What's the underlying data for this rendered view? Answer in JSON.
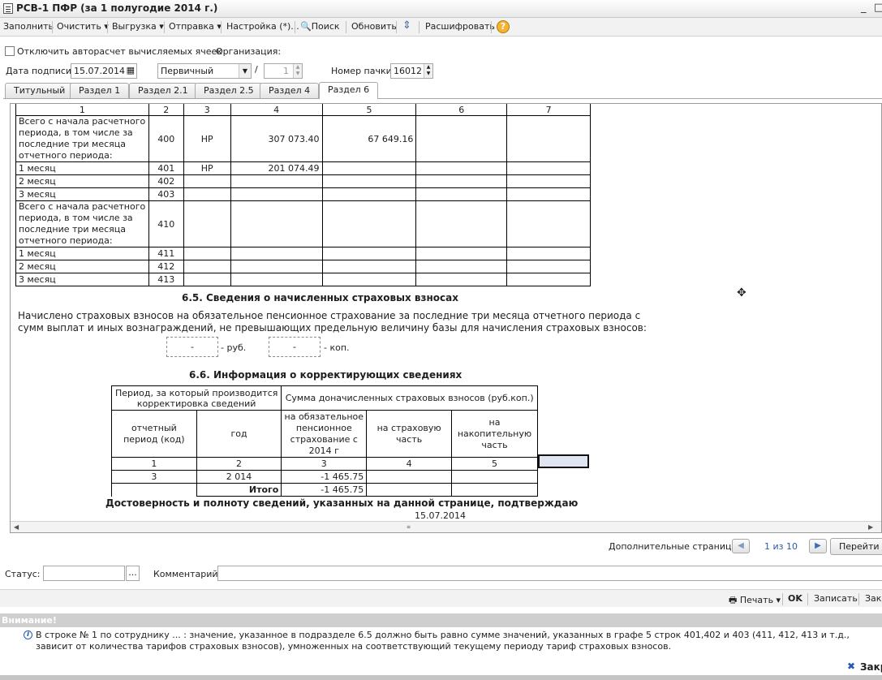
{
  "window": {
    "title": "РСВ-1 ПФР (за 1 полугодие 2014 г.)"
  },
  "toolbar": {
    "fill": "Заполнить",
    "clear": "Очистить",
    "export": "Выгрузка",
    "send": "Отправка",
    "settings": "Настройка (*)...",
    "search": "Поиск",
    "refresh": "Обновить",
    "decode": "Расшифровать",
    "help": "?"
  },
  "form": {
    "autocalc_label": "Отключить авторасчет вычисляемых ячеек",
    "org_label": "Организация:",
    "date_label": "Дата подписи:",
    "date_value": "15.07.2014",
    "type_value": "Первичный",
    "slash": "/",
    "corr_num": "1",
    "pack_label": "Номер пачки:",
    "pack_value": "16012"
  },
  "tabs": [
    "Титульный",
    "Раздел 1",
    "Раздел 2.1",
    "Раздел 2.5",
    "Раздел 4",
    "Раздел 6"
  ],
  "active_tab": "Раздел 6",
  "table1": {
    "headers": [
      "1",
      "2",
      "3",
      "4",
      "5",
      "6",
      "7"
    ],
    "rows": [
      {
        "desc": "Всего с начала расчетного периода, в том числе за последние три месяца отчетного периода:",
        "code": "400",
        "tariff": "НР",
        "c4": "307 073.40",
        "c5": "67 649.16",
        "c6": "",
        "c7": ""
      },
      {
        "desc": "1 месяц",
        "code": "401",
        "tariff": "НР",
        "c4": "201 074.49",
        "c5": "",
        "c6": "",
        "c7": ""
      },
      {
        "desc": "2 месяц",
        "code": "402",
        "tariff": "",
        "c4": "",
        "c5": "",
        "c6": "",
        "c7": ""
      },
      {
        "desc": "3 месяц",
        "code": "403",
        "tariff": "",
        "c4": "",
        "c5": "",
        "c6": "",
        "c7": ""
      },
      {
        "desc": "Всего с начала расчетного периода, в том числе за последние три месяца отчетного периода:",
        "code": "410",
        "tariff": "",
        "c4": "",
        "c5": "",
        "c6": "",
        "c7": ""
      },
      {
        "desc": "1 месяц",
        "code": "411",
        "tariff": "",
        "c4": "",
        "c5": "",
        "c6": "",
        "c7": ""
      },
      {
        "desc": "2 месяц",
        "code": "412",
        "tariff": "",
        "c4": "",
        "c5": "",
        "c6": "",
        "c7": ""
      },
      {
        "desc": "3 месяц",
        "code": "413",
        "tariff": "",
        "c4": "",
        "c5": "",
        "c6": "",
        "c7": ""
      }
    ]
  },
  "sec65": {
    "title": "6.5. Сведения о начисленных страховых взносах",
    "line1": "Начислено страховых взносов на обязательное пенсионное страхование за последние три месяца отчетного периода с",
    "line2": "сумм выплат и иных вознаграждений, не превышающих предельную величину базы для начисления страховых взносов:",
    "rub_value": "-",
    "rub_label": "- руб.",
    "kop_value": "-",
    "kop_label": "- коп."
  },
  "sec66": {
    "title": "6.6. Информация о корректирующих сведениях",
    "h_period": "Период, за который производится корректировка сведений",
    "h_sum": "Сумма доначисленных страховых взносов (руб.коп.)",
    "h_code": "отчетный период (код)",
    "h_year": "год",
    "h_ops": "на обязательное пенсионное страхование с 2014 г",
    "h_ins": "на страховую часть",
    "h_acc": "на накопительную часть",
    "nums": [
      "1",
      "2",
      "3",
      "4",
      "5"
    ],
    "row": {
      "code": "3",
      "year": "2 014",
      "ops": "-1 465.75",
      "ins": "",
      "acc": ""
    },
    "total_label": "Итого",
    "total_ops": "-1 465.75"
  },
  "confirm": {
    "text": "Достоверность и полноту сведений, указанных на данной странице, подтверждаю",
    "date": "15.07.2014"
  },
  "nav": {
    "extra_pages": "Дополнительные страницы",
    "page_info": "1 из 10",
    "go": "Перейти"
  },
  "status": {
    "status_label": "Статус:",
    "comment_label": "Комментарий:",
    "ellipsis": "..."
  },
  "actions": {
    "print": "Печать",
    "ok": "OK",
    "save": "Записать",
    "close": "Закрыть"
  },
  "warning": {
    "title": "Внимание!",
    "line1": "В строке № 1 по сотруднику ... : значение, указанное в подразделе 6.5 должно быть равно сумме значений, указанных в графе 5 строк 401,402 и 403 (411, 412, 413 и т.д.,",
    "line2": "зависит от количества тарифов страховых взносов), умноженных на соответствующий текущему периоду тариф страховых взносов.",
    "close": "Закрыть"
  }
}
